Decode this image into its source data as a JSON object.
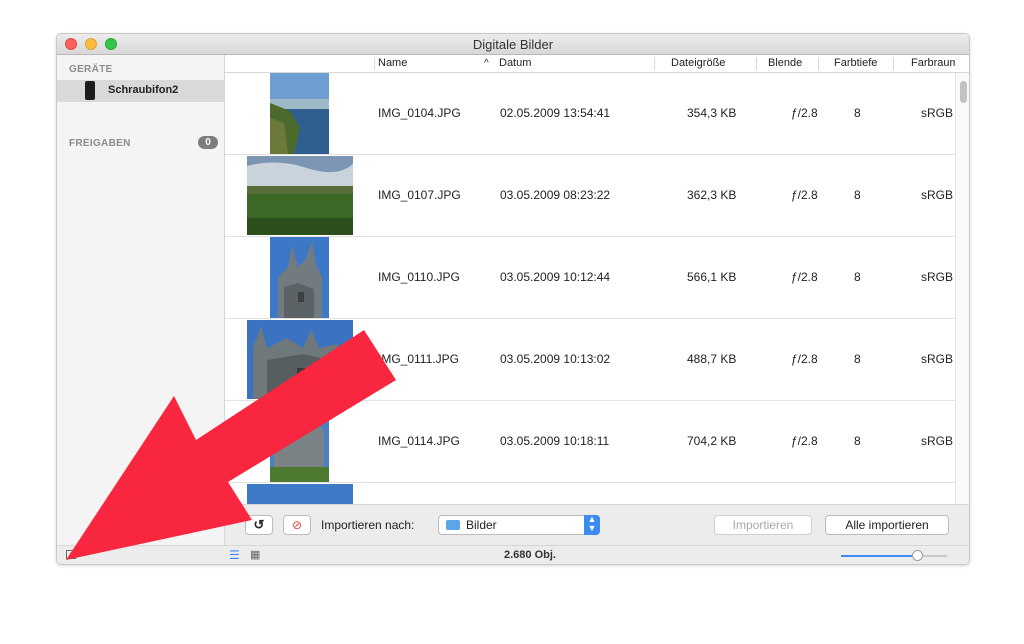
{
  "window": {
    "title": "Digitale Bilder"
  },
  "sidebar": {
    "devices_heading": "GERÄTE",
    "device_name": "Schraubifon2",
    "shares_heading": "FREIGABEN",
    "shares_count": "0"
  },
  "columns": {
    "name": "Name",
    "sort_indicator": "^",
    "date": "Datum",
    "size": "Dateigröße",
    "aperture": "Blende",
    "depth": "Farbtiefe",
    "colorspace": "Farbraum"
  },
  "rows": [
    {
      "name": "IMG_0104.JPG",
      "date": "02.05.2009 13:54:41",
      "size": "354,3 KB",
      "aperture": "ƒ/2.8",
      "depth": "8",
      "colorspace": "sRGB"
    },
    {
      "name": "IMG_0107.JPG",
      "date": "03.05.2009 08:23:22",
      "size": "362,3 KB",
      "aperture": "ƒ/2.8",
      "depth": "8",
      "colorspace": "sRGB"
    },
    {
      "name": "IMG_0110.JPG",
      "date": "03.05.2009 10:12:44",
      "size": "566,1 KB",
      "aperture": "ƒ/2.8",
      "depth": "8",
      "colorspace": "sRGB"
    },
    {
      "name": "IMG_0111.JPG",
      "date": "03.05.2009 10:13:02",
      "size": "488,7 KB",
      "aperture": "ƒ/2.8",
      "depth": "8",
      "colorspace": "sRGB"
    },
    {
      "name": "IMG_0114.JPG",
      "date": "03.05.2009 10:18:11",
      "size": "704,2 KB",
      "aperture": "ƒ/2.8",
      "depth": "8",
      "colorspace": "sRGB"
    }
  ],
  "toolbar": {
    "rotate_icon": "rotate-left-icon",
    "delete_icon": "no-entry-icon",
    "import_to_label": "Importieren nach:",
    "destination": "Bilder",
    "import_button": "Importieren",
    "import_all_button": "Alle importieren"
  },
  "status": {
    "count": "2.680 Obj.",
    "zoom_level": 0.75
  },
  "colors": {
    "accent": "#3b8cf2",
    "annotation_arrow": "#f8273f"
  }
}
